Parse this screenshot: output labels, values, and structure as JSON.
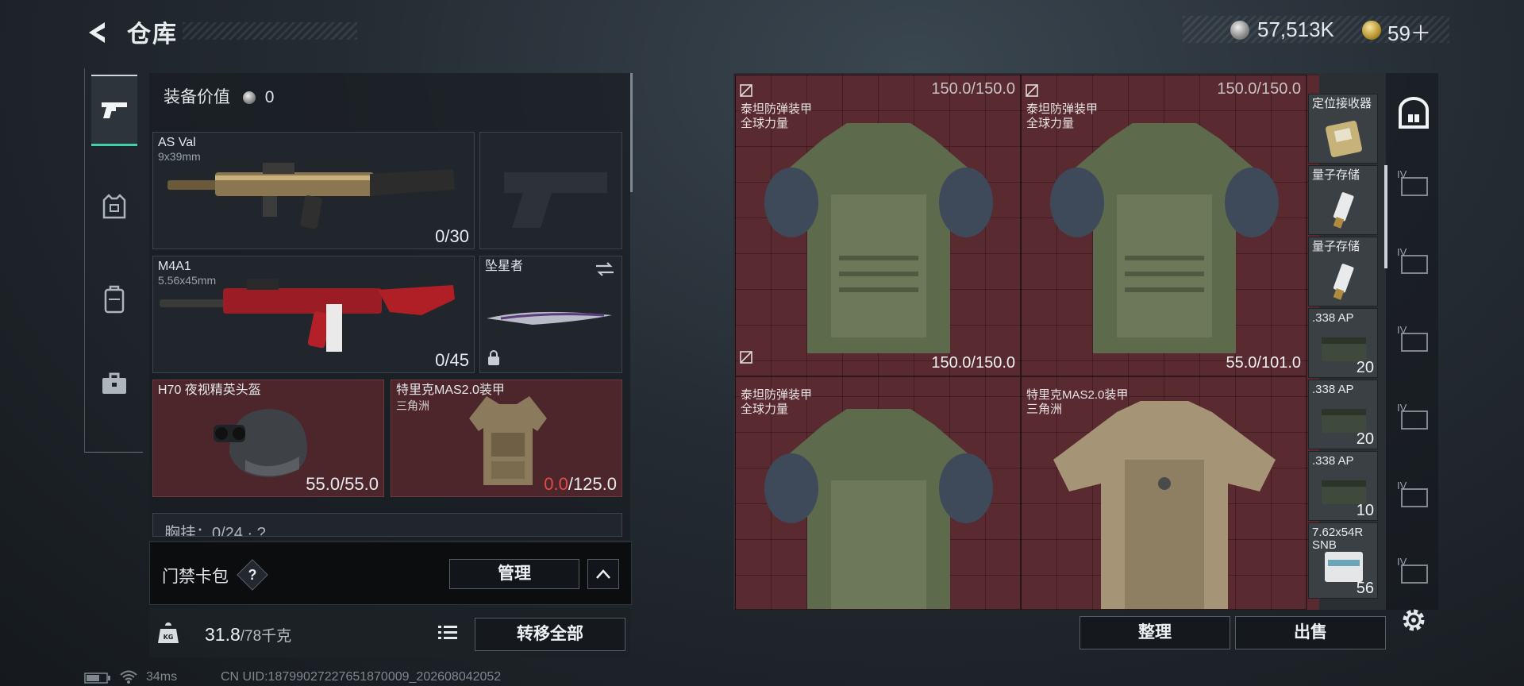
{
  "header": {
    "title": "仓库"
  },
  "currency": {
    "silver": "57,513K",
    "gold": "59＋"
  },
  "equipment": {
    "title": "装备价值",
    "value": "0",
    "primary": {
      "name": "AS Val",
      "caliber": "9x39mm",
      "ammo": "0/30"
    },
    "secondary": {
      "name": "M4A1",
      "caliber": "5.56x45mm",
      "ammo": "0/45"
    },
    "melee": {
      "name": "坠星者"
    },
    "helmet": {
      "name": "H70 夜视精英头盔",
      "durability": "55.0/55.0"
    },
    "armor": {
      "name": "特里克MAS2.0装甲",
      "sub": "三角洲",
      "dur_current": "0.0",
      "dur_max": "/125.0"
    },
    "chest_label": "胸挂：0/24 · ?"
  },
  "cardbag": {
    "label": "门禁卡包",
    "help": "?",
    "manage": "管理"
  },
  "weight": {
    "current": "31.8",
    "max": "/78千克",
    "transfer_all": "转移全部"
  },
  "stash": {
    "cells": [
      {
        "name": "泰坦防弹装甲",
        "sub": "全球力量",
        "top_value": "150.0/150.0",
        "bottom_value": "150.0/150.0"
      },
      {
        "name": "泰坦防弹装甲",
        "sub": "全球力量",
        "top_value": "150.0/150.0",
        "bottom_value": "55.0/101.0"
      },
      {
        "name": "泰坦防弹装甲",
        "sub": "全球力量"
      },
      {
        "name": "特里克MAS2.0装甲",
        "sub": "三角洲"
      }
    ],
    "small_items": [
      {
        "name": "定位接收器",
        "count": ""
      },
      {
        "name": "量子存储",
        "count": ""
      },
      {
        "name": "量子存储",
        "count": ""
      },
      {
        "name": ".338 AP",
        "count": "20"
      },
      {
        "name": ".338 AP",
        "count": "20"
      },
      {
        "name": ".338 AP",
        "count": "10"
      },
      {
        "name": "7.62x54R SNB",
        "count": "56"
      }
    ],
    "side_tier": "IV",
    "sort": "整理",
    "sell": "出售"
  },
  "status": {
    "ping": "34ms",
    "uid": "CN UID:18799027227651870009_202608042052"
  },
  "colors": {
    "accent": "#3fd1a8",
    "slot_red": "#4d262b",
    "zero_red": "#e24b4b"
  }
}
